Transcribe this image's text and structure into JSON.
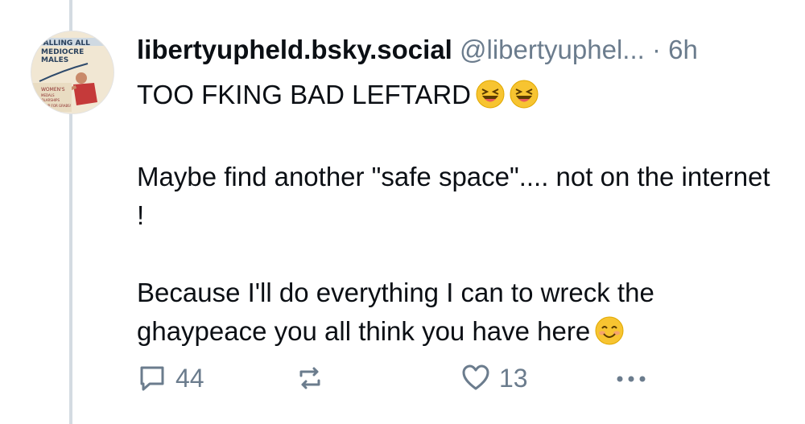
{
  "post": {
    "avatar_text": [
      "CALLING ALL",
      "MEDIOCRE",
      "MALES",
      "WOMEN'S",
      "MEDALS",
      "SCHOLARSHIPS",
      "SHOW UP FOR GRABS!"
    ],
    "display_name": "libertyupheld.bsky.social",
    "handle": "@libertyuphel...",
    "separator": "·",
    "timestamp": "6h",
    "lines": [
      "TOO FKING BAD LEFTARD",
      "Maybe find another \"safe space\".... not on the internet !",
      "Because I'll do everything I can to wreck the ghaypeace you all think you have here"
    ],
    "emojis": [
      "laughing-face-icon",
      "laughing-face-icon",
      "smiling-face-icon"
    ],
    "actions": {
      "reply_count": "44",
      "like_count": "13"
    }
  },
  "colors": {
    "text": "#0b0f14",
    "muted": "#6b7c8d",
    "thread_line": "#d4dbe2",
    "emoji_yellow": "#f7c431"
  }
}
